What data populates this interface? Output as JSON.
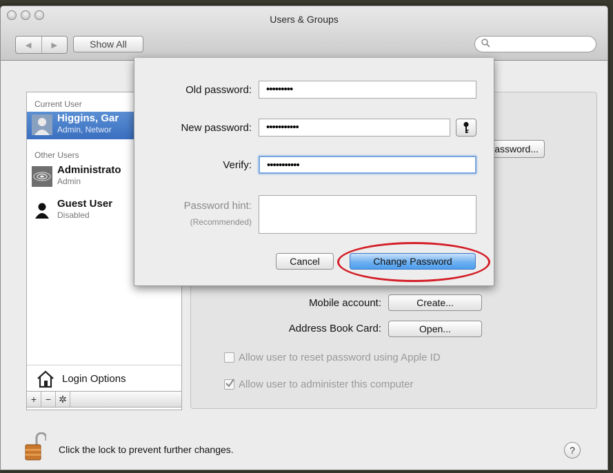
{
  "window": {
    "title": "Users & Groups"
  },
  "toolbar": {
    "back": "◀",
    "forward": "▶",
    "show_all": "Show All",
    "search_placeholder": ""
  },
  "sidebar": {
    "current_user_heading": "Current User",
    "other_users_heading": "Other Users",
    "users": [
      {
        "name": "Higgins, Gar",
        "role": "Admin, Networ"
      },
      {
        "name": "Administrato",
        "role": "Admin"
      },
      {
        "name": "Guest User",
        "role": "Disabled"
      }
    ],
    "login_options": "Login Options",
    "bar": {
      "add": "+",
      "remove": "−",
      "gear": "✲"
    }
  },
  "panel": {
    "change_password_button": "Change Password...",
    "mobile_account_label": "Mobile account:",
    "mobile_account_button": "Create...",
    "address_book_label": "Address Book Card:",
    "address_book_button": "Open...",
    "reset_with_apple_id": "Allow user to reset password using Apple ID",
    "administer_computer": "Allow user to administer this computer",
    "administer_checked": true,
    "reset_checked": false
  },
  "sheet": {
    "old_password_label": "Old password:",
    "old_password_value": "•••••••••",
    "new_password_label": "New password:",
    "new_password_value": "•••••••••••",
    "verify_label": "Verify:",
    "verify_value": "•••••••••••",
    "hint_label": "Password hint:",
    "hint_sublabel": "(Recommended)",
    "hint_value": "",
    "cancel_button": "Cancel",
    "change_password_button": "Change Password"
  },
  "footer": {
    "lock_text": "Click the lock to prevent further changes.",
    "help": "?"
  },
  "colors": {
    "selection": "#3a6fc0",
    "focus_ring": "#7aa7e0",
    "annotation": "#d41e27"
  }
}
